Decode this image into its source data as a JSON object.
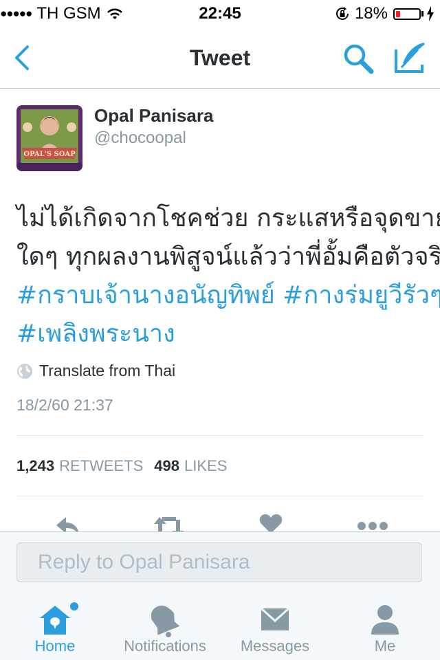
{
  "status_bar": {
    "signal": "●●●●●",
    "carrier": "TH GSM",
    "time": "22:45",
    "battery_pct": "18%",
    "battery_level": 0.18
  },
  "nav": {
    "title": "Tweet"
  },
  "tweet": {
    "author_name": "Opal Panisara",
    "author_handle": "@chocoopal",
    "text_line_1": "ไม่ได้เกิดจากโชคช่วย กระแสหรือจุดขาย",
    "text_line_2": "ใดๆ ทุกผลงานพิสูจน์แล้วว่าพี่อั้มคือตัวจริง",
    "hashtag_1": "#กราบเจ้านางอนัญทิพย์",
    "hashtag_2": "#กางร่มยูวีรัวๆ",
    "hashtag_3": "#เพลิงพระนาง",
    "translate_label": "Translate from Thai",
    "timestamp": "18/2/60 21:37",
    "retweets_count": "1,243",
    "retweets_label": "RETWEETS",
    "likes_count": "498",
    "likes_label": "LIKES"
  },
  "reply": {
    "placeholder": "Reply to Opal Panisara"
  },
  "tabs": [
    {
      "label": "Home",
      "icon": "home-icon",
      "active": true
    },
    {
      "label": "Notifications",
      "icon": "bell-icon",
      "active": false
    },
    {
      "label": "Messages",
      "icon": "envelope-icon",
      "active": false
    },
    {
      "label": "Me",
      "icon": "person-icon",
      "active": false
    }
  ],
  "colors": {
    "accent": "#2b9ee0",
    "secondary_text": "#8899a6",
    "battery_low": "#ff1e1e"
  }
}
